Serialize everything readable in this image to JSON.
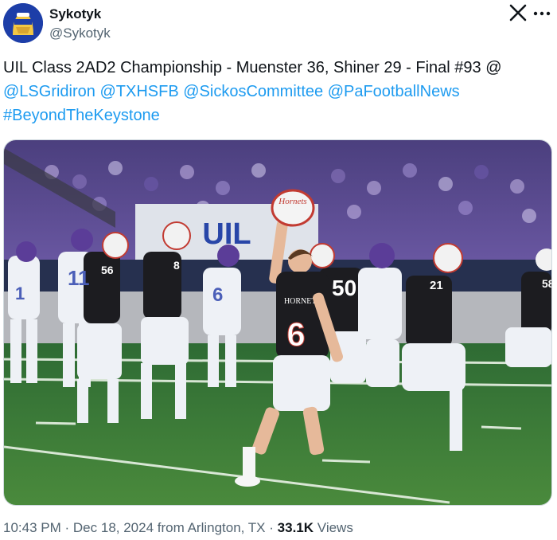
{
  "author": {
    "display_name": "Sykotyk",
    "handle": "@Sykotyk",
    "avatar_icon": "masked-mascot-avatar"
  },
  "header_icons": {
    "platform_logo": "x-logo-icon",
    "more_options": "more-options-icon"
  },
  "tweet": {
    "text": "UIL Class 2AD2 Championship - Muenster 36, Shiner 29 - Final #93 @",
    "mentions_line": [
      "@LSGridiron",
      "@TXHSFB",
      "@SickosCommittee",
      "@PaFootballNews"
    ],
    "hashtag": "#BeyondTheKeystone"
  },
  "media": {
    "banner_text": "UIL",
    "helmet_text": "Hornets",
    "jersey_text": "HORNETS",
    "jersey_numbers": [
      "6",
      "56",
      "8",
      "50",
      "21",
      "11",
      "1",
      "6",
      "58"
    ],
    "colors": {
      "home_jersey": "#1c1c20",
      "away_jersey": "#eef1f6",
      "away_helmet": "#5b3d98",
      "field": "#3f7d3a",
      "crowd": "#4b3f7e"
    }
  },
  "meta": {
    "time": "10:43 PM",
    "date": "Dec 18, 2024",
    "location_text": "from Arlington, TX",
    "views_count": "33.1K",
    "views_label": "Views",
    "separator": "·"
  }
}
